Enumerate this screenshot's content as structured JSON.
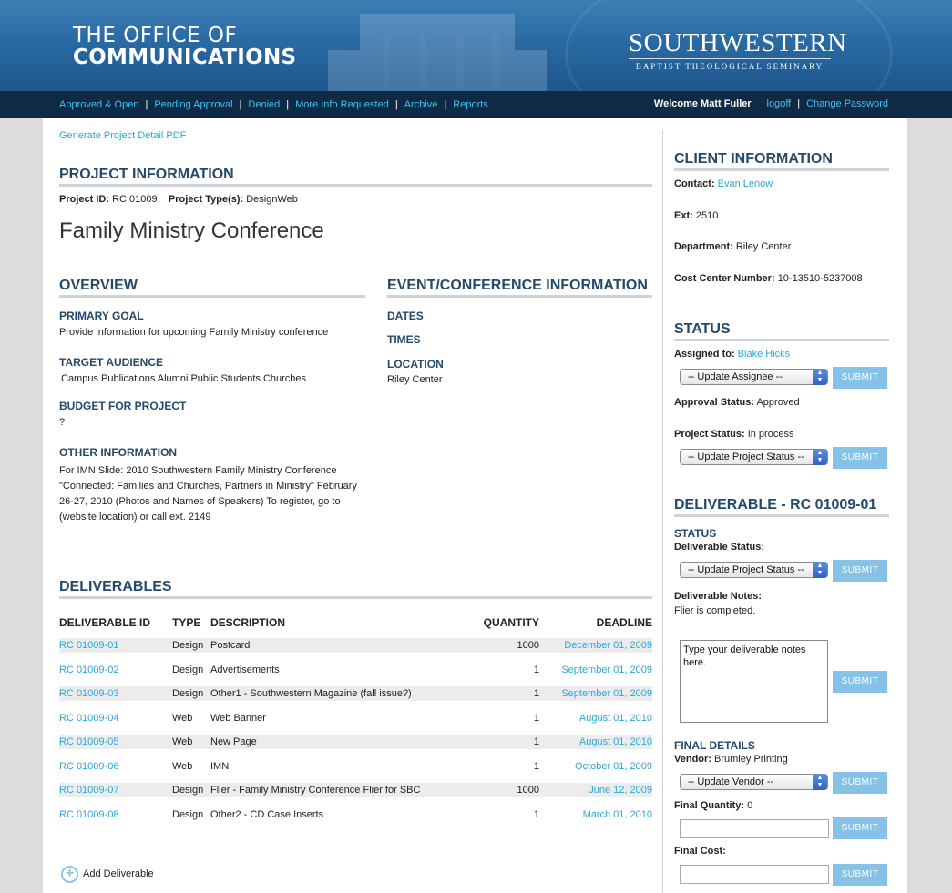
{
  "header": {
    "office_line1": "THE OFFICE OF",
    "office_line2": "COMMUNICATIONS",
    "brand_name": "SOUTHWESTERN",
    "brand_sub": "BAPTIST THEOLOGICAL SEMINARY"
  },
  "nav": {
    "items": [
      "Approved & Open",
      "Pending Approval",
      "Denied",
      "More Info Requested",
      "Archive",
      "Reports"
    ],
    "separator": "|",
    "welcome": "Welcome Matt Fuller",
    "logoff": "logoff",
    "change_password": "Change Password"
  },
  "pdf_link": "Generate Project Detail PDF",
  "project": {
    "heading": "PROJECT INFORMATION",
    "id_label": "Project ID:",
    "id": "RC 01009",
    "type_label": "Project Type(s):",
    "type": "DesignWeb",
    "title": "Family Ministry Conference"
  },
  "overview": {
    "heading": "OVERVIEW",
    "primary_goal_label": "PRIMARY GOAL",
    "primary_goal": "Provide information for upcoming Family Ministry conference",
    "target_audience_label": "TARGET AUDIENCE",
    "target_audience": "Campus Publications Alumni Public Students Churches",
    "budget_label": "BUDGET FOR PROJECT",
    "budget": "?",
    "other_label": "OTHER INFORMATION",
    "other_lines": [
      "For IMN Slide: 2010 Southwestern Family Ministry Conference",
      "\"Connected: Families and Churches, Partners in Ministry\" February",
      "26-27, 2010 (Photos and Names of Speakers) To register, go to",
      "(website location) or call ext. 2149"
    ]
  },
  "event": {
    "heading": "EVENT/CONFERENCE INFORMATION",
    "dates_label": "DATES",
    "times_label": "TIMES",
    "location_label": "LOCATION",
    "location": "Riley Center"
  },
  "deliverables": {
    "heading": "DELIVERABLES",
    "columns": [
      "DELIVERABLE ID",
      "TYPE",
      "DESCRIPTION",
      "QUANTITY",
      "DEADLINE"
    ],
    "rows": [
      {
        "id": "RC 01009-01",
        "type": "Design",
        "description": "Postcard",
        "quantity": "1000",
        "deadline": "December 01, 2009"
      },
      {
        "id": "RC 01009-02",
        "type": "Design",
        "description": "Advertisements",
        "quantity": "1",
        "deadline": "September 01, 2009"
      },
      {
        "id": "RC 01009-03",
        "type": "Design",
        "description": "Other1 - Southwestern Magazine (fall issue?)",
        "quantity": "1",
        "deadline": "September 01, 2009"
      },
      {
        "id": "RC 01009-04",
        "type": "Web",
        "description": "Web Banner",
        "quantity": "1",
        "deadline": "August 01, 2010"
      },
      {
        "id": "RC 01009-05",
        "type": "Web",
        "description": "New Page",
        "quantity": "1",
        "deadline": "August 01, 2010"
      },
      {
        "id": "RC 01009-06",
        "type": "Web",
        "description": "IMN",
        "quantity": "1",
        "deadline": "October 01, 2009"
      },
      {
        "id": "RC 01009-07",
        "type": "Design",
        "description": "Flier - Family Ministry Conference Flier for SBC",
        "quantity": "1000",
        "deadline": "June 12, 2009"
      },
      {
        "id": "RC 01009-08",
        "type": "Design",
        "description": "Other2 - CD Case Inserts",
        "quantity": "1",
        "deadline": "March 01, 2010"
      }
    ],
    "add_label": "Add Deliverable"
  },
  "client": {
    "heading": "CLIENT INFORMATION",
    "contact_label": "Contact:",
    "contact": "Evan Lenow",
    "ext_label": "Ext:",
    "ext": "2510",
    "department_label": "Department:",
    "department": "Riley Center",
    "cost_center_label": "Cost Center Number:",
    "cost_center": "10-13510-5237008"
  },
  "status": {
    "heading": "STATUS",
    "assigned_label": "Assigned to:",
    "assigned": "Blake Hicks",
    "assignee_select": "-- Update Assignee --",
    "approval_label": "Approval Status:",
    "approval": "Approved",
    "project_status_label": "Project Status:",
    "project_status": "In process",
    "project_status_select": "-- Update Project Status --",
    "submit": "SUBMIT"
  },
  "deliverable_detail": {
    "heading": "DELIVERABLE - RC 01009-01",
    "status_heading": "STATUS",
    "deliverable_status_label": "Deliverable Status:",
    "status_select": "-- Update Project Status --",
    "notes_label": "Deliverable Notes:",
    "notes": "Flier is completed.",
    "notes_placeholder": "Type your deliverable notes here.",
    "final_heading": "FINAL DETAILS",
    "vendor_label": "Vendor:",
    "vendor": "Brumley Printing",
    "vendor_select": "-- Update Vendor --",
    "quantity_label": "Final Quantity:",
    "quantity": "0",
    "cost_label": "Final Cost:"
  },
  "colors": {
    "accent_link": "#2aa8d8",
    "heading": "#244a6b",
    "button": "#86c2e8",
    "nav_bg": "#0f2a45"
  }
}
